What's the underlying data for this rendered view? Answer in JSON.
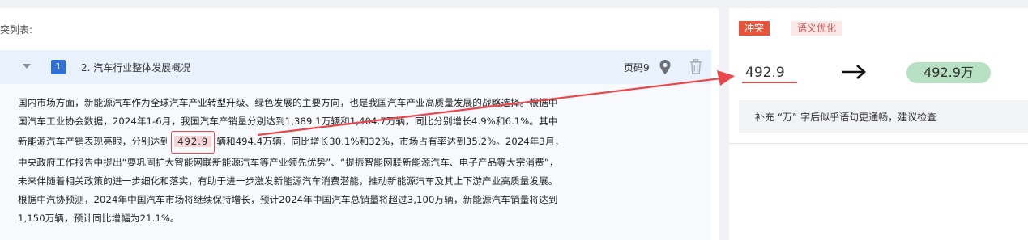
{
  "list_title": "突列表:",
  "item": {
    "number": "1",
    "title": "2. 汽车行业整体发展概况",
    "page_label": "页码9"
  },
  "paragraph": {
    "line1": "国内市场方面，新能源汽车作为全球汽车产业转型升级、绿色发展的主要方向，也是我国汽车产业高质量发展的战略选择。根据中",
    "line2": "国汽车工业协会数据，2024年1-6月，我国汽车产销量分别达到1,389.1万辆和1,404.7万辆，同比分别增长4.9%和6.1%。其中",
    "line3_before": "新能源汽车产销表现亮眼，分别达到",
    "line3_highlight": "492.9",
    "line3_after": "辆和494.4万辆，同比增长30.1%和32%，市场占有率达到35.2%。2024年3月，",
    "line4": "中央政府工作报告中提出“要巩固扩大智能网联新能源汽车等产业领先优势”、“提振智能网联新能源汽车、电子产品等大宗消费”，",
    "line5": "未来伴随着相关政策的进一步细化和落实，有助于进一步激发新能源汽车消费潜能，推动新能源汽车及其上下游产业高质量发展。",
    "line6": "根据中汽协预测，2024年中国汽车市场将继续保持增长，预计2024年中国汽车总销量将超过3,100万辆，新能源汽车销量将达到",
    "line7": "1,150万辆，预计同比增幅为21.1%。"
  },
  "right_panel": {
    "tag_conflict": "冲突",
    "tag_semantic": "语义优化",
    "original_value": "492.9",
    "suggested_value": "492.9万",
    "suggestion_text": "补充 “万” 字后似乎语句更通畅，建议检查"
  },
  "icons": {
    "collapse": "chevron-down-icon",
    "location": "map-pin-icon",
    "delete": "trash-icon",
    "arrow": "arrow-right-icon"
  },
  "colors": {
    "accent_blue": "#2f6fd8",
    "conflict_red": "#e8543a",
    "highlight_pink": "#f4d6d8",
    "suggestion_green": "#b8e0c2"
  }
}
